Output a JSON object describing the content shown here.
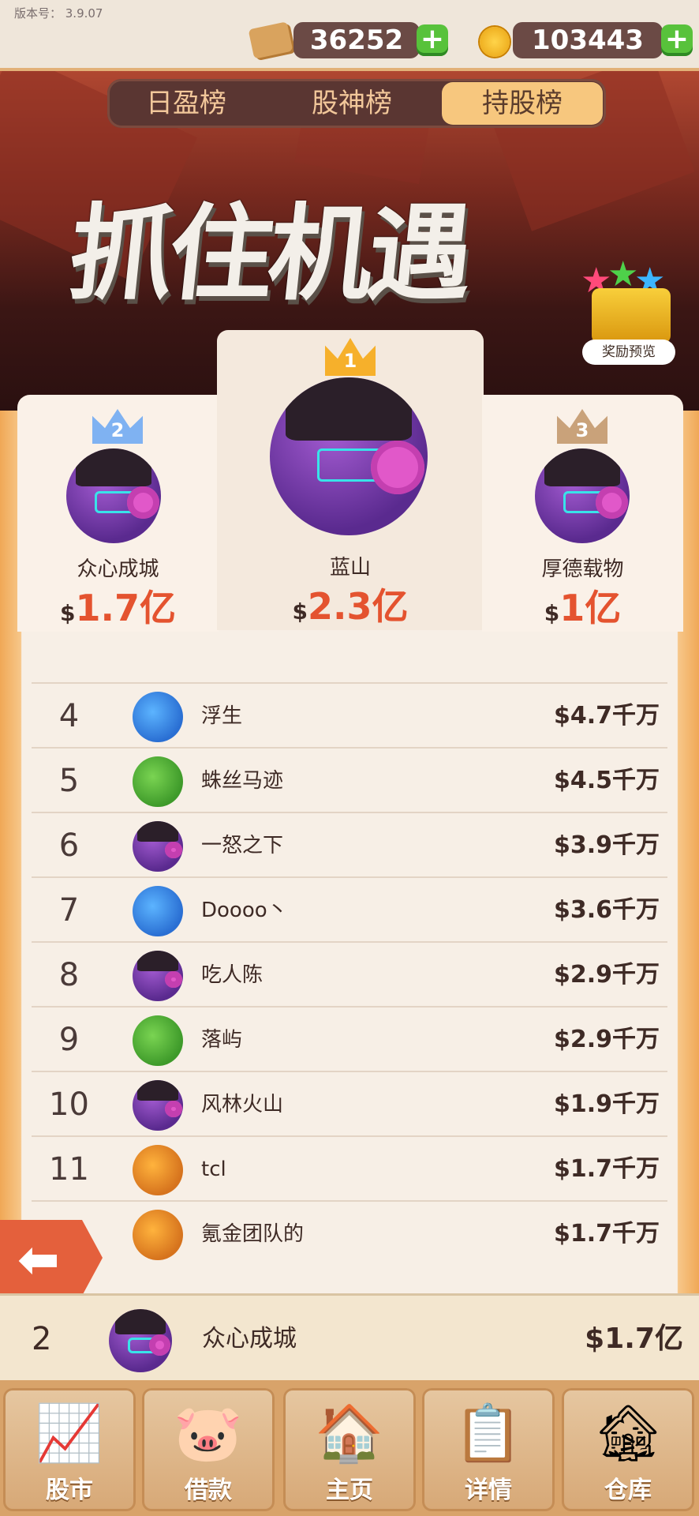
{
  "version": "版本号： 3.9.07",
  "resources": [
    {
      "icon": "ticket-icon",
      "value": "36252"
    },
    {
      "icon": "coin-icon",
      "value": "103443"
    }
  ],
  "tabs": [
    "日盈榜",
    "股神榜",
    "持股榜"
  ],
  "active_tab": "持股榜",
  "banner": "抓住机遇",
  "reward_label": "奖励预览",
  "top3": [
    {
      "rank": "2",
      "name": "众心成城",
      "currency": "$",
      "amount": "1.7亿"
    },
    {
      "rank": "1",
      "name": "蓝山",
      "currency": "$",
      "amount": "2.3亿"
    },
    {
      "rank": "3",
      "name": "厚德载物",
      "currency": "$",
      "amount": "1亿"
    }
  ],
  "rows": [
    {
      "rank": "4",
      "name": "浮生",
      "amount": "$4.7千万"
    },
    {
      "rank": "5",
      "name": "蛛丝马迹",
      "amount": "$4.5千万"
    },
    {
      "rank": "6",
      "name": "一怒之下",
      "amount": "$3.9千万"
    },
    {
      "rank": "7",
      "name": "Doooo丶",
      "amount": "$3.6千万"
    },
    {
      "rank": "8",
      "name": "吃人陈",
      "amount": "$2.9千万"
    },
    {
      "rank": "9",
      "name": "落屿",
      "amount": "$2.9千万"
    },
    {
      "rank": "10",
      "name": "风林火山",
      "amount": "$1.9千万"
    },
    {
      "rank": "11",
      "name": "tcl",
      "amount": "$1.7千万"
    },
    {
      "rank": "",
      "name": "氪金团队的",
      "amount": "$1.7千万"
    }
  ],
  "my_rank": {
    "rank": "2",
    "name": "众心成城",
    "amount": "$1.7亿"
  },
  "nav": [
    "股市",
    "借款",
    "主页",
    "详情",
    "仓库"
  ],
  "colors": {
    "accent": "#e4532f",
    "tab_active": "#f7c77e",
    "plus": "#58c23b"
  }
}
